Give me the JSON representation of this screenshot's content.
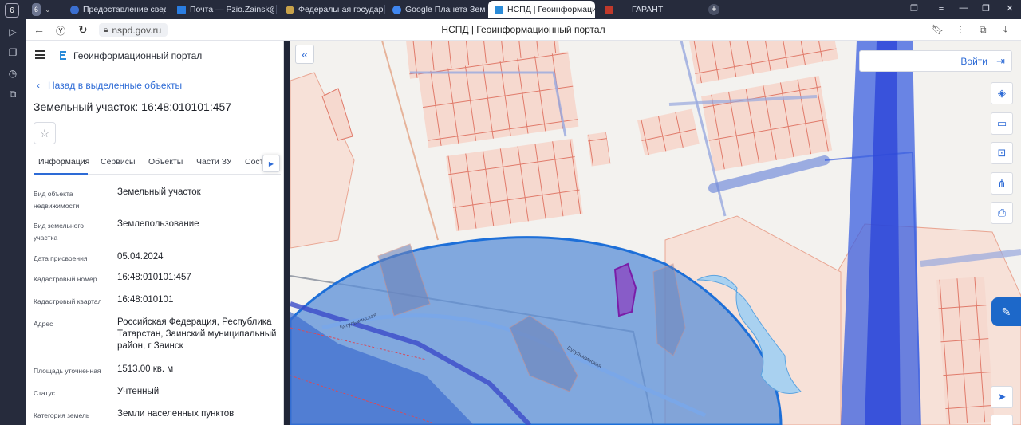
{
  "browser": {
    "badge_left": "6",
    "tabs": [
      {
        "label": "6",
        "color": "#6c7590"
      },
      {
        "label": "Предоставление сведен",
        "color": "#3b6fd0"
      },
      {
        "label": "Почта — Pzio.Zainsk@tata",
        "color": "#2a7de1"
      },
      {
        "label": "Федеральная государств",
        "color": "#c8a24a"
      },
      {
        "label": "Google Планета Земля",
        "color": "#3f86f0"
      },
      {
        "label": "НСПД | Геоинформаци",
        "color": "#2a8bd8"
      },
      {
        "label": "ГАРАНТ",
        "color": "#c0392b"
      }
    ],
    "url": "nspd.gov.ru",
    "page_title": "НСПД | Геоинформационный портал"
  },
  "panel": {
    "portal_title": "Геоинформационный портал",
    "back_label": "Назад в выделенные объекты",
    "object_title": "Земельный участок: 16:48:010101:457",
    "tabs": [
      "Информация",
      "Сервисы",
      "Объекты",
      "Части ЗУ",
      "Соста"
    ],
    "fields": [
      {
        "label": "Вид объекта недвижимости",
        "value": "Земельный участок"
      },
      {
        "label": "Вид земельного участка",
        "value": "Землепользование"
      },
      {
        "label": "Дата присвоения",
        "value": "05.04.2024"
      },
      {
        "label": "Кадастровый номер",
        "value": "16:48:010101:457"
      },
      {
        "label": "Кадастровый квартал",
        "value": "16:48:010101"
      },
      {
        "label": "Адрес",
        "value": "Российская Федерация, Республика Татарстан, Заинский муниципальный район, г Заинск"
      },
      {
        "label": "Площадь уточненная",
        "value": "1513.00 кв. м"
      },
      {
        "label": "Статус",
        "value": "Учтенный"
      },
      {
        "label": "Категория земель",
        "value": "Земли населенных пунктов"
      }
    ]
  },
  "map": {
    "login_label": "Войти",
    "road_labels": [
      "Бугульминская",
      "Бугульминская"
    ],
    "colors": {
      "parcel_stroke": "#e07a6a",
      "parcel_fill": "#f6d9cf",
      "zone_fill": "#5b8fd8",
      "zone_stroke": "#1d6fd8",
      "selected_fill": "#8a4fc4",
      "road_blue": "#3b5fe0"
    },
    "tools": [
      "layers-icon",
      "ruler-icon",
      "select-area-icon",
      "share-icon",
      "print-icon",
      "locate-icon"
    ]
  }
}
